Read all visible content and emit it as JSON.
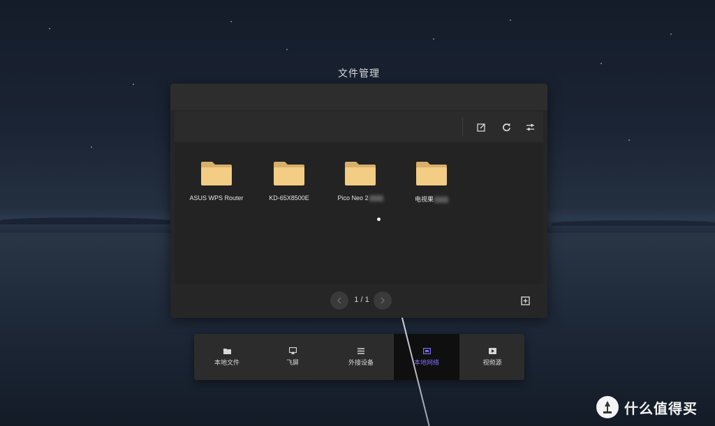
{
  "window": {
    "title": "文件管理"
  },
  "toolbar": {
    "icons": [
      "edit-icon",
      "refresh-icon",
      "settings-sliders-icon"
    ]
  },
  "files": [
    {
      "name": "ASUS WPS Router",
      "icon": "folder-icon"
    },
    {
      "name": "KD-65X8500E",
      "icon": "folder-icon"
    },
    {
      "name": "Pico Neo 2",
      "icon": "folder-icon"
    },
    {
      "name": "电视果",
      "icon": "folder-icon"
    }
  ],
  "pager": {
    "text": "1 / 1"
  },
  "dock": {
    "items": [
      {
        "label": "本地文件",
        "icon": "folder-icon",
        "active": false
      },
      {
        "label": "飞屏",
        "icon": "cast-icon",
        "active": false
      },
      {
        "label": "外接设备",
        "icon": "list-icon",
        "active": false
      },
      {
        "label": "本地网络",
        "icon": "network-icon",
        "active": true
      },
      {
        "label": "视频源",
        "icon": "play-icon",
        "active": false
      }
    ]
  },
  "watermark": {
    "text": "什么值得买"
  },
  "colors": {
    "folder": "#f3cd83",
    "accent": "#7b6cf6",
    "panel": "#262626"
  }
}
